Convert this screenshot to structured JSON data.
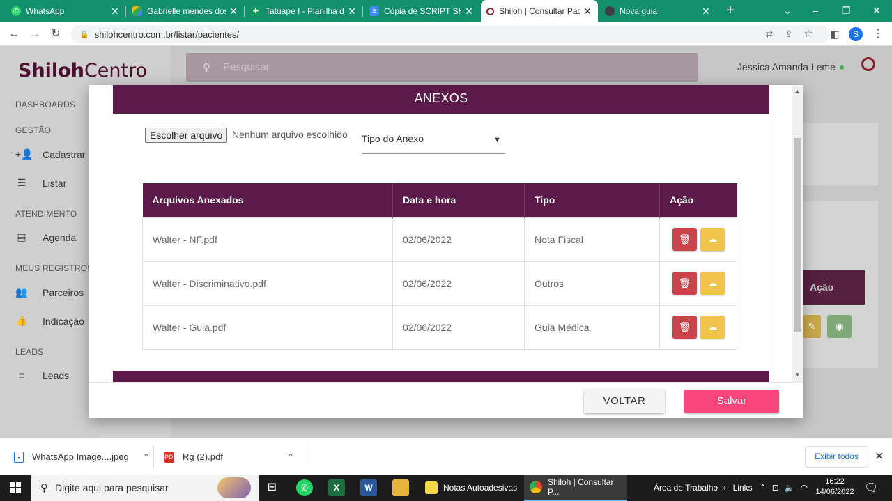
{
  "browser": {
    "tabs": [
      {
        "title": "WhatsApp",
        "icon": "whatsapp-icon",
        "active": false
      },
      {
        "title": "Gabrielle mendes dos",
        "icon": "drive-icon",
        "active": false
      },
      {
        "title": "Tatuape I - Planilha de",
        "icon": "sheets-icon",
        "active": false
      },
      {
        "title": "Cópia de SCRIPT SHIL",
        "icon": "docs-icon",
        "active": false
      },
      {
        "title": "Shiloh | Consultar Pac",
        "icon": "shiloh-icon",
        "active": true
      },
      {
        "title": "Nova guia",
        "icon": "chrome-icon",
        "active": false
      }
    ],
    "new_tab": "+",
    "url": "shilohcentro.com.br/listar/pacientes/",
    "profile_initial": "S"
  },
  "app": {
    "logo_bold": "Shiloh",
    "logo_light": "Centro",
    "search_placeholder": "Pesquisar",
    "user_name": "Jessica Amanda Leme",
    "sidebar": {
      "sections": [
        {
          "title": "DASHBOARDS",
          "items": []
        },
        {
          "title": "GESTÃO",
          "items": [
            {
              "label": "Cadastrar",
              "icon": "person-add-icon"
            },
            {
              "label": "Listar",
              "icon": "list-icon"
            }
          ]
        },
        {
          "title": "ATENDIMENTO",
          "items": [
            {
              "label": "Agenda",
              "icon": "calendar-icon"
            }
          ]
        },
        {
          "title": "MEUS REGISTROS",
          "items": [
            {
              "label": "Parceiros",
              "icon": "people-icon"
            },
            {
              "label": "Indicação",
              "icon": "thumb-up-icon"
            }
          ]
        },
        {
          "title": "LEADS",
          "items": [
            {
              "label": "Leads",
              "icon": "menu-icon"
            }
          ]
        }
      ]
    },
    "background_action_header": "Ação"
  },
  "modal": {
    "section_title": "ANEXOS",
    "file_button": "Escolher arquivo",
    "file_status": "Nenhum arquivo escolhido",
    "type_select": "Tipo do Anexo",
    "table": {
      "headers": [
        "Arquivos Anexados",
        "Data e hora",
        "Tipo",
        "Ação"
      ],
      "rows": [
        {
          "file": "Walter - NF.pdf",
          "date": "02/06/2022",
          "type": "Nota Fiscal"
        },
        {
          "file": "Walter - Discriminativo.pdf",
          "date": "02/06/2022",
          "type": "Outros"
        },
        {
          "file": "Walter - Guia.pdf",
          "date": "02/06/2022",
          "type": "Guia Médica"
        }
      ]
    },
    "back_button": "VOLTAR",
    "save_button": "Salvar"
  },
  "downloads": {
    "items": [
      {
        "name": "WhatsApp Image....jpeg",
        "icon": "image-file-icon"
      },
      {
        "name": "Rg  (2).pdf",
        "icon": "pdf-file-icon"
      }
    ],
    "show_all": "Exibir todos"
  },
  "taskbar": {
    "search_placeholder": "Digite aqui para pesquisar",
    "apps": [
      {
        "label": "Notas Autoadesivas"
      },
      {
        "label": "Shiloh | Consultar P..."
      }
    ],
    "desktop_label": "Área de Trabalho",
    "links_label": "Links",
    "time": "16:22",
    "date": "14/06/2022"
  },
  "colors": {
    "brand_purple": "#5b1a49",
    "save_pink": "#f7467a",
    "delete_red": "#c9444a",
    "download_yellow": "#f0c34b",
    "tabstrip_green": "#12906d"
  }
}
